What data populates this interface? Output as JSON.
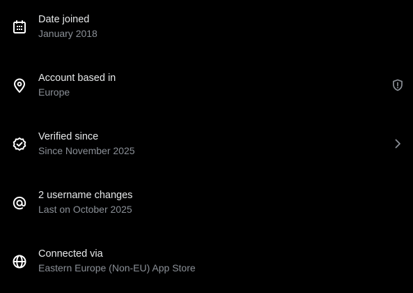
{
  "colors": {
    "background": "#000000",
    "primary_text": "#e7e9ea",
    "secondary_text": "#8b9097",
    "icon": "#ffffff"
  },
  "rows": [
    {
      "icon": "calendar-icon",
      "label": "Date joined",
      "value": "January 2018"
    },
    {
      "icon": "location-pin-icon",
      "label": "Account based in",
      "value": "Europe",
      "trailing_icon": "shield-alert-icon"
    },
    {
      "icon": "verified-badge-icon",
      "label": "Verified since",
      "value": "Since November 2025",
      "trailing_icon": "chevron-right-icon"
    },
    {
      "icon": "at-sign-icon",
      "label": "2 username changes",
      "value": "Last on October 2025"
    },
    {
      "icon": "globe-icon",
      "label": "Connected via",
      "value": "Eastern Europe (Non-EU) App Store"
    }
  ]
}
